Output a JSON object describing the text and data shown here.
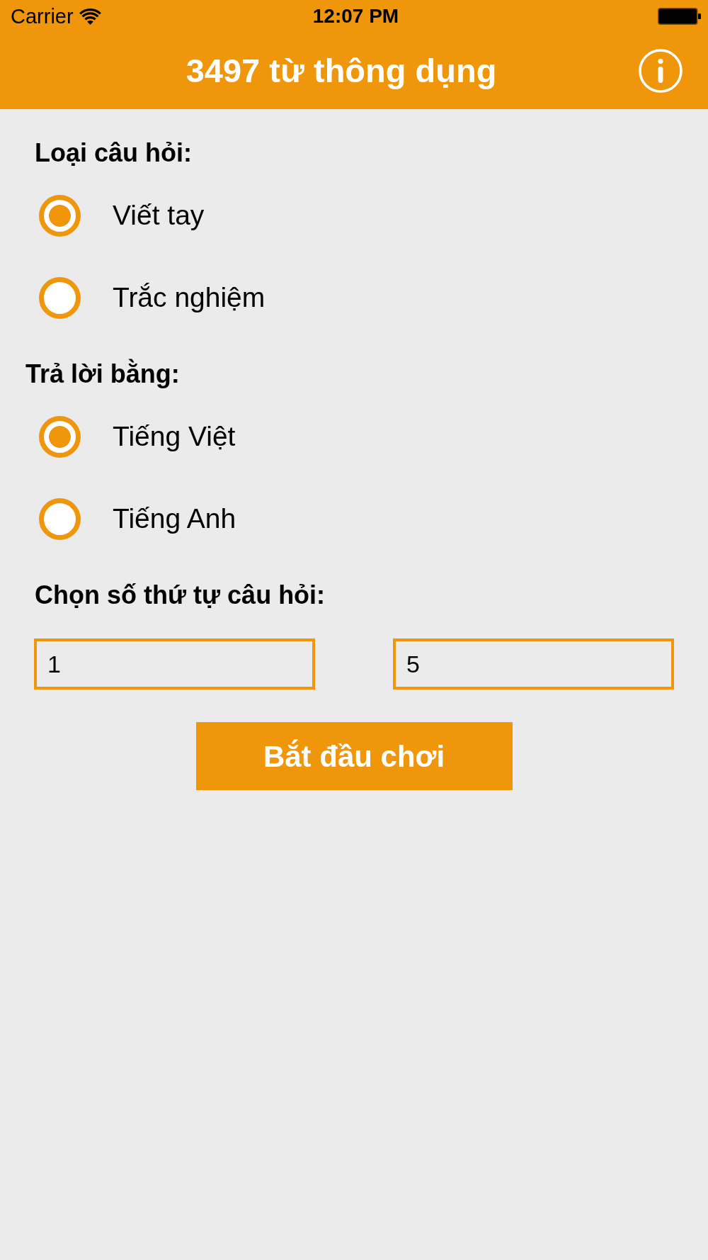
{
  "status_bar": {
    "carrier": "Carrier",
    "time": "12:07 PM"
  },
  "nav_bar": {
    "title": "3497 từ thông dụng"
  },
  "sections": [
    {
      "label": "Loại câu hỏi:",
      "options": [
        {
          "label": "Viết tay",
          "selected": true
        },
        {
          "label": "Trắc nghiệm",
          "selected": false
        }
      ]
    },
    {
      "label": "Trả lời bằng:",
      "options": [
        {
          "label": "Tiếng Việt",
          "selected": true
        },
        {
          "label": "Tiếng Anh",
          "selected": false
        }
      ]
    }
  ],
  "range": {
    "label": "Chọn số thứ tự câu hỏi:",
    "fields": [
      {
        "value": "1"
      },
      {
        "value": "5"
      }
    ]
  },
  "start_button": {
    "label": "Bắt đầu chơi"
  }
}
